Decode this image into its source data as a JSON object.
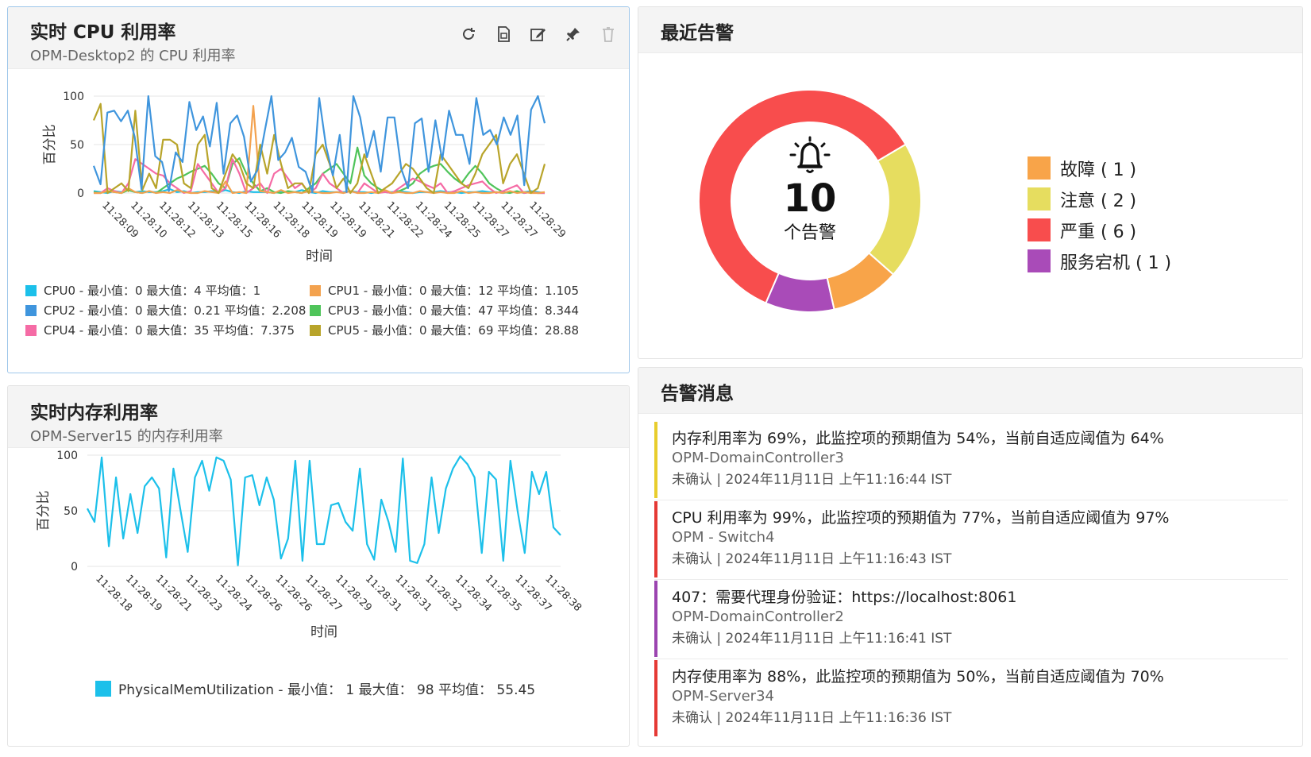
{
  "cpu": {
    "title": "实时 CPU 利用率",
    "subtitle": "OPM-Desktop2 的 CPU 利用率",
    "tools": [
      "refresh-icon",
      "export-icon",
      "edit-icon",
      "pin-icon",
      "delete-icon"
    ],
    "legend": [
      {
        "text": "CPU0 - 最小值：0 最大值：4 平均值：1",
        "color": "#1cc0ea"
      },
      {
        "text": "CPU1 - 最小值：0 最大值：12 平均值：1.105",
        "color": "#f3a24f"
      },
      {
        "text": "CPU2 - 最小值：0 最大值：0.21 平均值：2.208",
        "color": "#3f95dd"
      },
      {
        "text": "CPU3 - 最小值：0 最大值：47 平均值：8.344",
        "color": "#4fc45a"
      },
      {
        "text": "CPU4 - 最小值：0 最大值：35 平均值：7.375",
        "color": "#f56ba5"
      },
      {
        "text": "CPU5 - 最小值：0 最大值：69 平均值：28.88",
        "color": "#b8a42a"
      }
    ]
  },
  "mem": {
    "title": "实时内存利用率",
    "subtitle": "OPM-Server15 的内存利用率",
    "legend": {
      "text": "PhysicalMemUtilization - 最小值： 1 最大值： 98   平均值： 55.45",
      "color": "#1cc0ea"
    }
  },
  "alarms": {
    "title": "最近告警",
    "count": "10",
    "count_label": "个告警",
    "legend": [
      {
        "label": "故障 ( 1 )",
        "color": "#f8a449"
      },
      {
        "label": "注意 ( 2 )",
        "color": "#e6dd5f"
      },
      {
        "label": "严重 ( 6 )",
        "color": "#f84d4d"
      },
      {
        "label": "服务宕机 ( 1 )",
        "color": "#a94bb8"
      }
    ]
  },
  "messages": {
    "title": "告警消息",
    "items": [
      {
        "text": "内存利用率为 69%，此监控项的预期值为 54%，当前自适应阈值为 64%",
        "source": "OPM-DomainController3",
        "status": "未确认 | 2024年11月11日 上午11:16:44 IST",
        "color": "#e8cd2d"
      },
      {
        "text": "CPU 利用率为 99%，此监控项的预期值为 77%，当前自适应阈值为 97%",
        "source": "OPM - Switch4",
        "status": "未确认 | 2024年11月11日 上午11:16:43 IST",
        "color": "#e53935"
      },
      {
        "text": "407：需要代理身份验证：https://localhost:8061",
        "source": "OPM-DomainController2",
        "status": "未确认 | 2024年11月11日 上午11:16:41 IST",
        "color": "#9b44b0"
      },
      {
        "text": "内存使用率为 88%，此监控项的预期值为 50%，当前自适应阈值为 70%",
        "source": "OPM-Server34",
        "status": "未确认 | 2024年11月11日 上午11:16:36 IST",
        "color": "#e53935"
      }
    ]
  },
  "chart_data": [
    {
      "type": "line",
      "title": "实时 CPU 利用率",
      "xlabel": "时间",
      "ylabel": "百分比",
      "ylim": [
        0,
        100
      ],
      "yticks": [
        "0",
        "50",
        "100"
      ],
      "grid": true,
      "legend_position": "bottom",
      "xticks": [
        "11:28:09",
        "11:28:10",
        "11:28:12",
        "11:28:13",
        "11:28:15",
        "11:28:16",
        "11:28:18",
        "11:28:19",
        "11:28:19",
        "11:28:21",
        "11:28:22",
        "11:28:24",
        "11:28:25",
        "11:28:27",
        "11:28:27",
        "11:28:29"
      ],
      "series": [
        {
          "name": "CPU0",
          "color": "#1cc0ea",
          "values": [
            2,
            1,
            0,
            2,
            1,
            3,
            1,
            2,
            1,
            1,
            2,
            4,
            1,
            2,
            0,
            1,
            1,
            2,
            1,
            3,
            1,
            0,
            2,
            1,
            1,
            1,
            0,
            2,
            1,
            1,
            3,
            1,
            0,
            2,
            1,
            1,
            1,
            2,
            1,
            1,
            0,
            1,
            1,
            1,
            2,
            1,
            0,
            1,
            1,
            1,
            2,
            1,
            1,
            0,
            1,
            1,
            2,
            1,
            1,
            0,
            1,
            1,
            1,
            2,
            1,
            0
          ]
        },
        {
          "name": "CPU1",
          "color": "#f3a24f",
          "values": [
            0,
            0,
            2,
            1,
            0,
            5,
            1,
            0,
            2,
            0,
            1,
            0,
            3,
            1,
            0,
            0,
            2,
            1,
            0,
            12,
            0,
            1,
            0,
            90,
            2,
            1,
            0,
            3,
            0,
            1,
            0,
            2,
            1,
            0,
            0,
            1,
            0,
            2,
            0,
            0,
            1,
            0,
            3,
            0,
            1,
            0,
            0,
            2,
            1,
            0,
            1,
            0,
            0,
            2,
            0,
            1,
            0,
            0,
            1,
            0,
            2,
            0,
            1,
            0,
            0,
            1
          ]
        },
        {
          "name": "CPU2",
          "color": "#3f95dd",
          "values": [
            28,
            9,
            83,
            85,
            74,
            85,
            58,
            4,
            100,
            38,
            32,
            2,
            42,
            32,
            94,
            65,
            79,
            48,
            93,
            20,
            72,
            80,
            58,
            12,
            24,
            63,
            100,
            34,
            42,
            57,
            27,
            22,
            1,
            98,
            48,
            18,
            60,
            1,
            100,
            78,
            37,
            64,
            22,
            78,
            78,
            25,
            5,
            72,
            77,
            22,
            75,
            34,
            85,
            60,
            60,
            30,
            98,
            60,
            65,
            50,
            78,
            60,
            80,
            8,
            86,
            100,
            72
          ]
        },
        {
          "name": "CPU3",
          "color": "#4fc45a",
          "values": [
            1,
            0,
            2,
            1,
            0,
            3,
            1,
            0,
            2,
            0,
            5,
            10,
            15,
            18,
            22,
            25,
            28,
            20,
            10,
            5,
            30,
            36,
            20,
            10,
            2,
            5,
            1,
            0,
            2,
            1,
            0,
            5,
            10,
            20,
            25,
            30,
            20,
            10,
            47,
            18,
            10,
            5,
            1,
            0,
            2,
            5,
            10,
            20,
            25,
            28,
            30,
            22,
            15,
            10,
            20,
            28,
            20,
            10,
            5,
            1,
            0,
            2,
            0,
            1,
            0,
            0
          ]
        },
        {
          "name": "CPU4",
          "color": "#f56ba5",
          "values": [
            0,
            0,
            5,
            2,
            0,
            10,
            35,
            30,
            25,
            20,
            18,
            10,
            5,
            0,
            2,
            30,
            20,
            10,
            0,
            5,
            35,
            20,
            0,
            5,
            10,
            0,
            20,
            25,
            15,
            5,
            10,
            0,
            5,
            20,
            10,
            5,
            0,
            2,
            0,
            10,
            5,
            0,
            1,
            0,
            5,
            10,
            15,
            12,
            8,
            5,
            10,
            0,
            2,
            5,
            8,
            10,
            12,
            5,
            0,
            2,
            5,
            8,
            0,
            1,
            0,
            0
          ]
        },
        {
          "name": "CPU5",
          "color": "#b8a42a",
          "values": [
            75,
            92,
            0,
            5,
            10,
            2,
            85,
            3,
            20,
            5,
            55,
            55,
            50,
            10,
            5,
            50,
            60,
            5,
            0,
            20,
            40,
            30,
            10,
            5,
            50,
            20,
            60,
            30,
            5,
            10,
            10,
            0,
            40,
            50,
            30,
            5,
            15,
            0,
            10,
            40,
            20,
            0,
            5,
            10,
            20,
            30,
            25,
            15,
            5,
            0,
            40,
            30,
            20,
            10,
            5,
            20,
            40,
            50,
            60,
            10,
            30,
            40,
            20,
            0,
            5,
            30
          ]
        }
      ]
    },
    {
      "type": "line",
      "title": "实时内存利用率",
      "xlabel": "时间",
      "ylabel": "百分比",
      "ylim": [
        0,
        100
      ],
      "yticks": [
        "0",
        "50",
        "100"
      ],
      "grid": true,
      "legend_position": "bottom",
      "xticks": [
        "11:28:18",
        "11:28:19",
        "11:28:21",
        "11:28:23",
        "11:28:24",
        "11:28:26",
        "11:28:26",
        "11:28:27",
        "11:28:29",
        "11:28:31",
        "11:28:31",
        "11:28:32",
        "11:28:34",
        "11:28:35",
        "11:28:37",
        "11:28:38"
      ],
      "series": [
        {
          "name": "PhysicalMemUtilization",
          "color": "#1cc0ea",
          "values": [
            52,
            40,
            98,
            18,
            80,
            25,
            65,
            30,
            72,
            80,
            70,
            8,
            88,
            50,
            13,
            80,
            95,
            68,
            98,
            95,
            78,
            1,
            80,
            82,
            55,
            80,
            60,
            7,
            25,
            95,
            5,
            95,
            20,
            20,
            55,
            57,
            40,
            32,
            88,
            20,
            6,
            60,
            40,
            13,
            97,
            5,
            3,
            20,
            80,
            30,
            70,
            88,
            99,
            92,
            80,
            12,
            85,
            78,
            5,
            95,
            50,
            12,
            85,
            65,
            85,
            35,
            28
          ]
        }
      ]
    },
    {
      "type": "pie",
      "title": "最近告警",
      "center_label": "10 个告警",
      "slices": [
        {
          "label": "故障",
          "value": 1,
          "color": "#f8a449"
        },
        {
          "label": "注意",
          "value": 2,
          "color": "#e6dd5f"
        },
        {
          "label": "严重",
          "value": 6,
          "color": "#f84d4d"
        },
        {
          "label": "服务宕机",
          "value": 1,
          "color": "#a94bb8"
        }
      ]
    }
  ]
}
